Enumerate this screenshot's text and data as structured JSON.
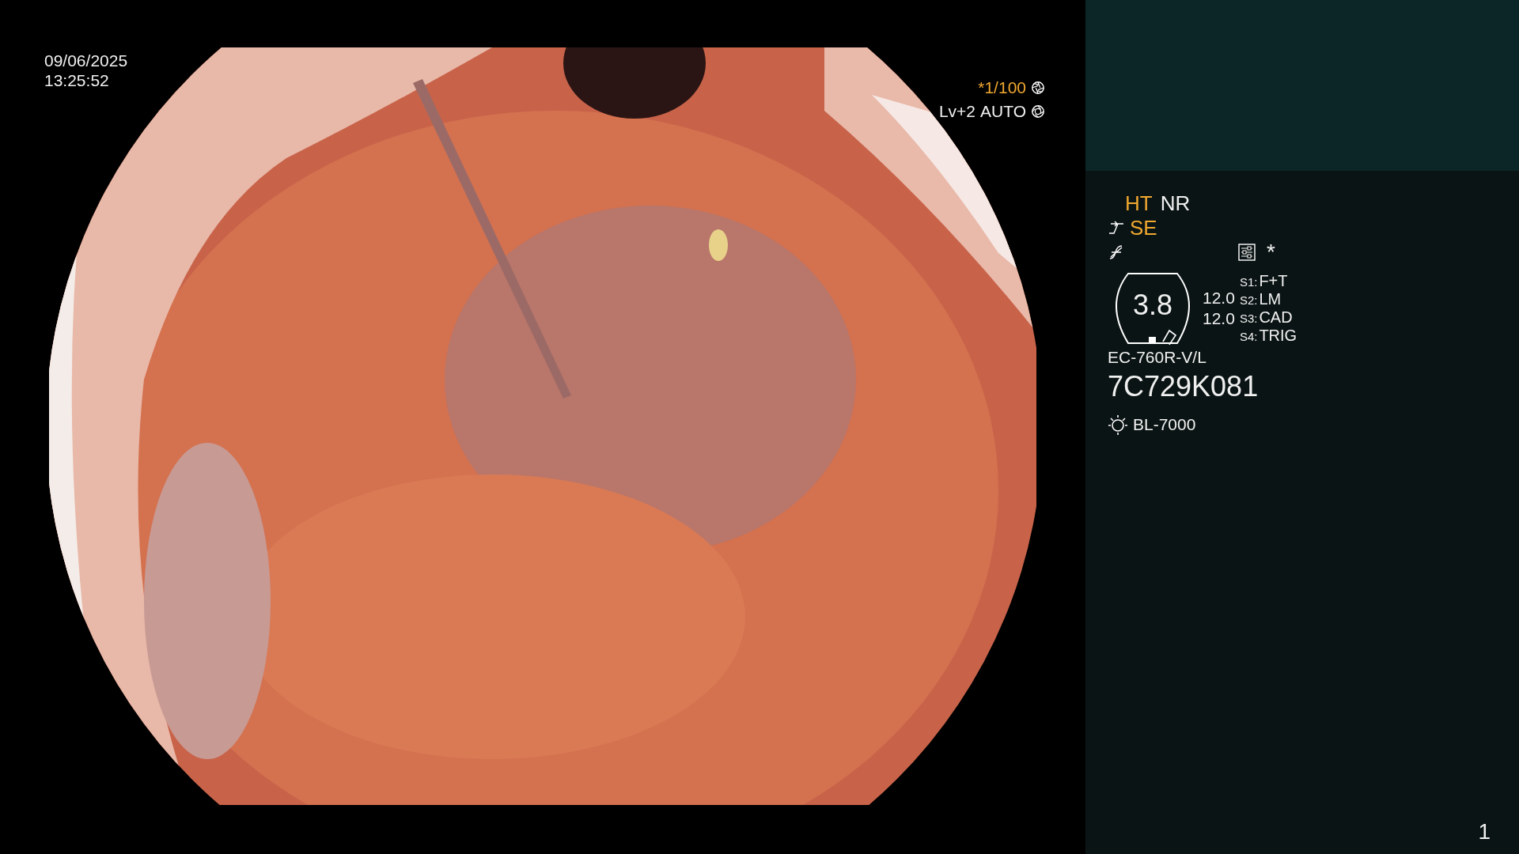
{
  "datetime": {
    "date": "09/06/2025",
    "time": "13:25:52"
  },
  "exposure": {
    "shutter": "*1/100",
    "level": "Lv+2",
    "mode": "AUTO"
  },
  "modes": [
    {
      "label": "HT",
      "on": true
    },
    {
      "label": "NR",
      "on": false
    }
  ],
  "enhance": {
    "label": "SE",
    "on": true
  },
  "settings_mark": "*",
  "gauge": {
    "reading": "3.8",
    "values": [
      "12.0",
      "12.0"
    ]
  },
  "switches": [
    {
      "key": "S1:",
      "value": "F+T"
    },
    {
      "key": "S2:",
      "value": "LM"
    },
    {
      "key": "S3:",
      "value": "CAD"
    },
    {
      "key": "S4:",
      "value": "TRIG"
    }
  ],
  "scope_model": "EC-760R-V/L",
  "serial": "7C729K081",
  "light_source": "BL-7000",
  "page": "1"
}
